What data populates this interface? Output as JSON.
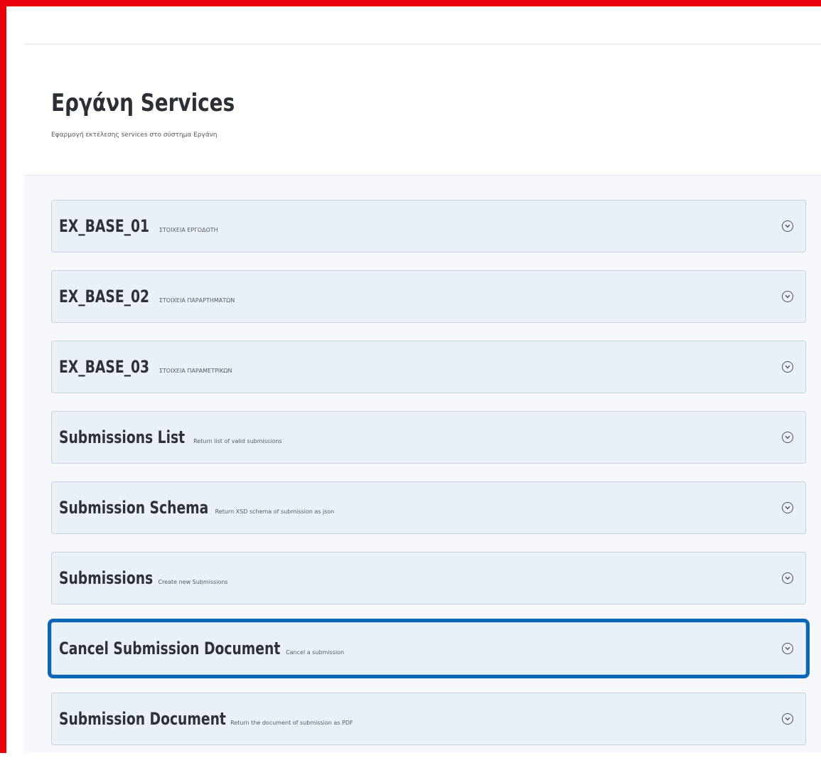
{
  "header": {
    "title": "Εργάνη Services",
    "subtitle": "Εφαρμογή εκτέλεσης services στο σύστημα Εργάνη"
  },
  "operations": [
    {
      "name": "EX_BASE_01",
      "description": "ΣΤΟΙΧΕΙΑ ΕΡΓΟΔΟΤΗ",
      "expand_icon": "chevron-circle-down-icon"
    },
    {
      "name": "EX_BASE_02",
      "description": "ΣΤΟΙΧΕΙΑ ΠΑΡΑΡΤΗΜΑΤΩΝ",
      "expand_icon": "chevron-circle-down-icon"
    },
    {
      "name": "EX_BASE_03",
      "description": "ΣΤΟΙΧΕΙΑ ΠΑΡΑΜΕΤΡΙΚΩΝ",
      "expand_icon": "chevron-circle-down-icon"
    },
    {
      "name": "Submissions List",
      "description": "Return list of valid submissions",
      "expand_icon": "chevron-circle-down-icon"
    },
    {
      "name": "Submission Schema",
      "description": "Return XSD schema of submission as json",
      "expand_icon": "chevron-circle-down-icon"
    },
    {
      "name": "Submissions",
      "description": "Create new Submissions",
      "expand_icon": "chevron-circle-down-icon"
    },
    {
      "name": "Cancel Submission Document",
      "description": "Cancel a submission",
      "expand_icon": "chevron-circle-down-icon"
    },
    {
      "name": "Submission Document",
      "description": "Return the document of submission as PDF",
      "expand_icon": "chevron-circle-down-icon"
    }
  ],
  "colors": {
    "frame_border": "#e8000b",
    "highlight_border": "#0a66b7",
    "operation_background": "#e9f0f8",
    "operation_border": "#c5d4e6"
  }
}
